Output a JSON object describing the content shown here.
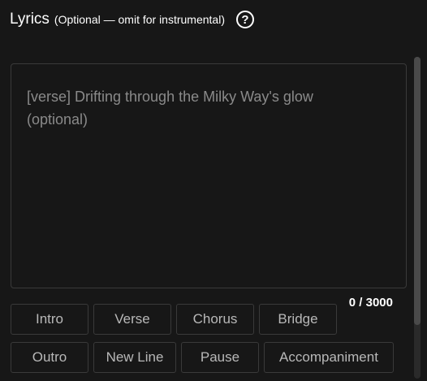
{
  "header": {
    "title": "Lyrics",
    "subtitle": "(Optional — omit for instrumental)",
    "help_icon": "question-circle-icon"
  },
  "lyrics": {
    "value": "",
    "placeholder": "[verse] Drifting through the Milky Way's glow\n(optional)"
  },
  "counter": {
    "text": "0 / 3000"
  },
  "tags": [
    {
      "label": "Intro"
    },
    {
      "label": "Verse"
    },
    {
      "label": "Chorus"
    },
    {
      "label": "Bridge"
    },
    {
      "label": "Outro"
    },
    {
      "label": "New Line"
    },
    {
      "label": "Pause"
    },
    {
      "label": "Accompaniment"
    }
  ],
  "colors": {
    "background": "#171717",
    "border": "#3a3a3a",
    "chip_text": "#b8b8b8",
    "placeholder": "#8a8a8a"
  }
}
